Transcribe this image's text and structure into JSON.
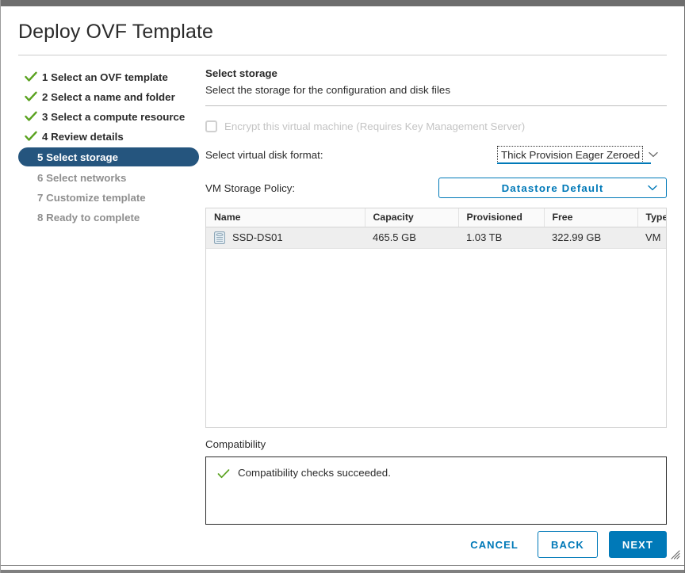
{
  "dialog": {
    "title": "Deploy OVF Template"
  },
  "sidebar": {
    "steps": [
      {
        "label": "1 Select an OVF template",
        "state": "done"
      },
      {
        "label": "2 Select a name and folder",
        "state": "done"
      },
      {
        "label": "3 Select a compute resource",
        "state": "done"
      },
      {
        "label": "4 Review details",
        "state": "done"
      },
      {
        "label": "5 Select storage",
        "state": "active"
      },
      {
        "label": "6 Select networks",
        "state": "pending"
      },
      {
        "label": "7 Customize template",
        "state": "pending"
      },
      {
        "label": "8 Ready to complete",
        "state": "pending"
      }
    ]
  },
  "content": {
    "heading": "Select storage",
    "subheading": "Select the storage for the configuration and disk files",
    "encrypt": {
      "label": "Encrypt this virtual machine (Requires Key Management Server)",
      "checked": false,
      "disabled": true
    },
    "disk_format": {
      "label": "Select virtual disk format:",
      "value": "Thick Provision Eager Zeroed",
      "caret_icon": "chevron-down-icon"
    },
    "storage_policy": {
      "label": "VM Storage Policy:",
      "value": "Datastore Default",
      "caret_icon": "chevron-down-icon"
    }
  },
  "datastore_table": {
    "columns": [
      "Name",
      "Capacity",
      "Provisioned",
      "Free",
      "Type"
    ],
    "rows": [
      {
        "icon": "datastore-icon",
        "name": "SSD-DS01",
        "capacity": "465.5 GB",
        "provisioned": "1.03 TB",
        "free": "322.99 GB",
        "type": "VM",
        "selected": true
      }
    ]
  },
  "compatibility": {
    "label": "Compatibility",
    "status_icon": "check-icon",
    "message": "Compatibility checks succeeded."
  },
  "footer": {
    "cancel_label": "CANCEL",
    "back_label": "BACK",
    "next_label": "NEXT",
    "resize_grip_icon": "resize-grip-icon"
  },
  "colors": {
    "accent_blue": "#0079b8",
    "active_step_navy": "#25557e",
    "success_green": "#5aa220",
    "disabled_grey": "#c4c4c4",
    "row_selected": "#eeeeee"
  }
}
